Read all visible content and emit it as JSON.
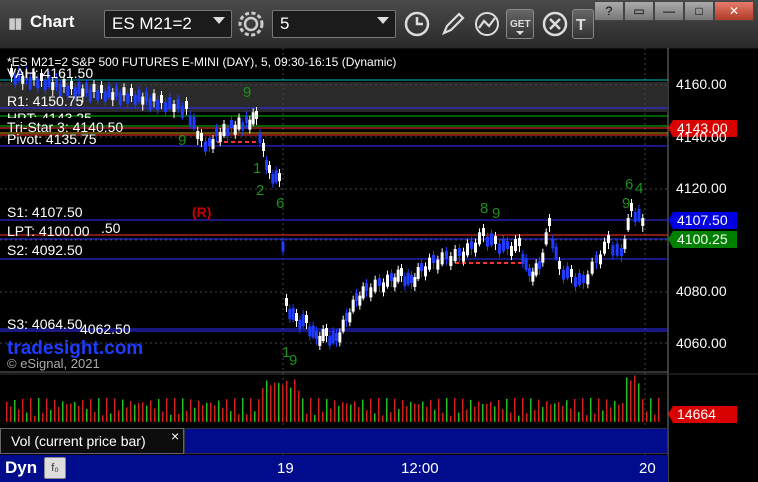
{
  "window": {
    "title": "Chart",
    "symbol": "ES M21=2",
    "interval": "5"
  },
  "toolbar_icons": [
    "settings-gear-icon",
    "clock-icon",
    "pencil-icon",
    "study-icon",
    "get-icon",
    "close-circle-icon",
    "text-icon"
  ],
  "window_controls": [
    "restore-icon",
    "tile-icon",
    "minimize-icon",
    "maximize-icon",
    "close-icon"
  ],
  "chart": {
    "header": "*ES M21=2 S&P 500 FUTURES E-MINI (DAY), 5, 09:30-16:15 (Dynamic)",
    "watermark": "tradesight.com",
    "copyright": "© eSignal, 2021",
    "marker": "(R)",
    "level_labels": {
      "vah": "VAH: 4161.50",
      "r1": "R1: 4150.75",
      "hpt": "HPT: 4143.25",
      "tristar": "Tri-Star 3: 4140.50",
      "pivot": "Pivot: 4135.75",
      "s1": "S1: 4107.50",
      "lpt": "LPT: 4100.00",
      "lpt_overlap": ".50",
      "s2": "S2: 4092.50",
      "s3": "S3: 4064.50",
      "s3_overlap": "4062.50"
    },
    "price_axis": [
      "4160.00",
      "4140.00",
      "4120.00",
      "4100.00",
      "4080.00",
      "4060.00"
    ],
    "price_tags": {
      "current": "4143.00",
      "s1": "4107.50",
      "lpt": "4100.25",
      "volume": "14664"
    },
    "time_axis": [
      "19",
      "12:00",
      "20"
    ],
    "td_counts": [
      "9",
      "9",
      "2",
      "1",
      "6",
      "1",
      "9",
      "8",
      "9",
      "4",
      "6",
      "9"
    ],
    "colors": {
      "background": "#000000",
      "up_candle": "#ffffff",
      "down_candle": "#1f3cff",
      "level_blue": "#2f2fff",
      "level_cyan": "#00c0c0",
      "level_green": "#00c000",
      "level_red": "#ff3030",
      "tag_red": "#d90000",
      "tag_blue": "#0000e0",
      "tag_green": "#008000"
    }
  },
  "volume_panel": {
    "label": "Vol (current price bar)",
    "close_symbol": "×"
  },
  "footer": {
    "label": "Dyn"
  }
}
